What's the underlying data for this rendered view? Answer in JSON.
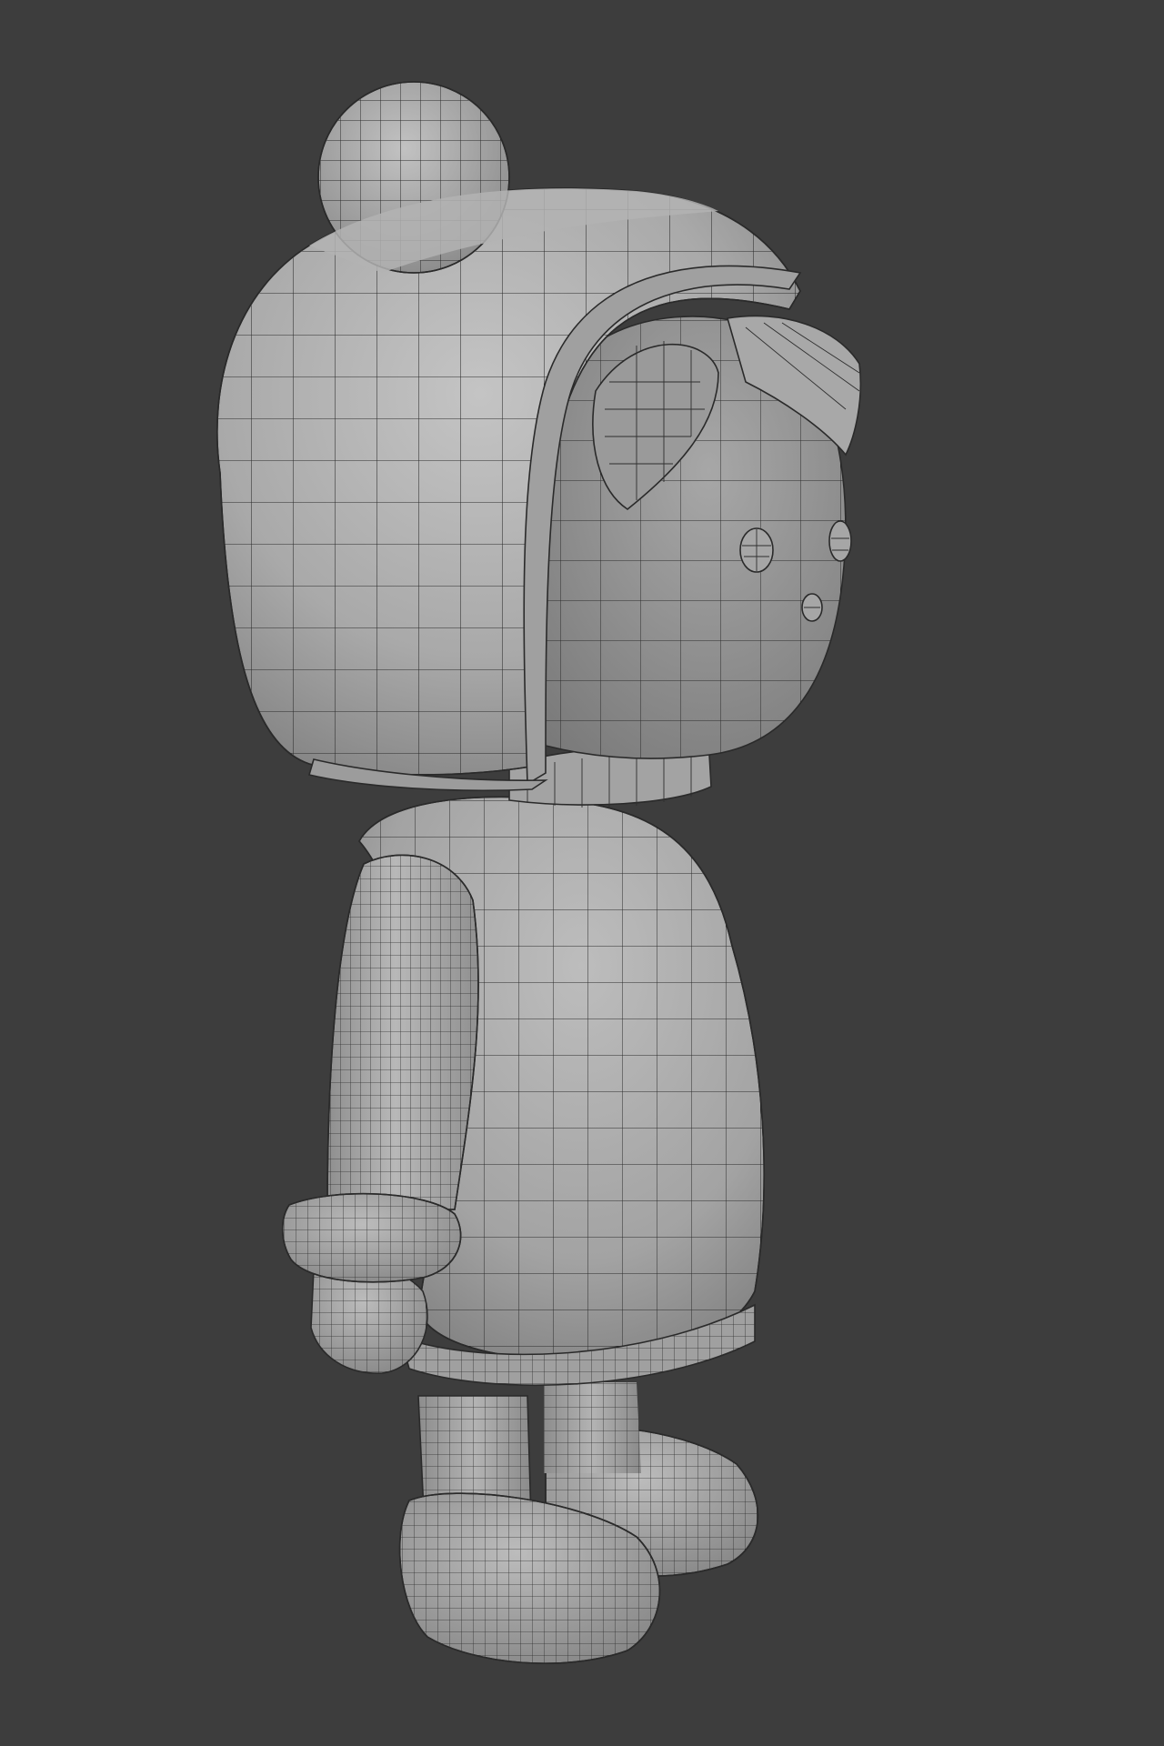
{
  "viewport": {
    "background_color": "#3d3d3d",
    "shade_light": "#c4c4c4",
    "shade_mid": "#a6a6a6",
    "shade_dark": "#7e7e7e",
    "wire_color": "#2b2b2b"
  },
  "model": {
    "shading": "solid-with-wireframe"
  }
}
